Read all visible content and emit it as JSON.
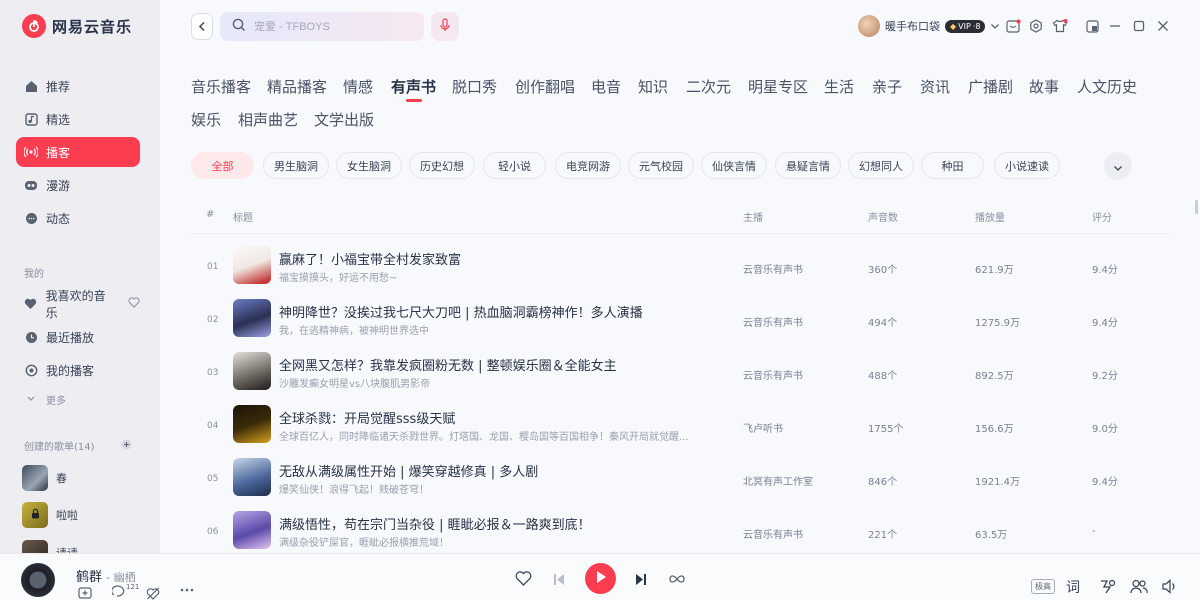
{
  "app": {
    "title": "网易云音乐",
    "accent": "#fc3d4f"
  },
  "sidebar": {
    "nav": [
      {
        "label": "推荐",
        "icon": "home-icon"
      },
      {
        "label": "精选",
        "icon": "music-note-icon"
      },
      {
        "label": "播客",
        "icon": "radio-icon",
        "active": true
      },
      {
        "label": "漫游",
        "icon": "glasses-icon"
      },
      {
        "label": "动态",
        "icon": "chat-icon"
      }
    ],
    "mine_label": "我的",
    "mine": [
      {
        "label": "我喜欢的音乐",
        "icon": "heart-icon"
      },
      {
        "label": "最近播放",
        "icon": "clock-icon"
      },
      {
        "label": "我的播客",
        "icon": "podcast-icon"
      }
    ],
    "more_label": "更多",
    "playlists_label": "创建的歌单(14)",
    "playlists": [
      {
        "name": "春"
      },
      {
        "name": "啦啦"
      },
      {
        "name": "请请"
      }
    ]
  },
  "topbar": {
    "search_placeholder": "宠爱 - TFBOYS",
    "user_name": "暖手布口袋",
    "vip_label": "VIP·",
    ".vip_level": "8",
    "vip_text": "VIP"
  },
  "categories": [
    "音乐播客",
    "精品播客",
    "情感",
    "有声书",
    "脱口秀",
    "创作翻唱",
    "电音",
    "知识",
    "二次元",
    "明星专区",
    "生活",
    "亲子",
    "资讯",
    "广播剧",
    "故事",
    "人文历史",
    "娱乐",
    "相声曲艺",
    "文学出版"
  ],
  "active_category": "有声书",
  "chips": [
    "全部",
    "男生脑洞",
    "女生脑洞",
    "历史幻想",
    "轻小说",
    "电竞网游",
    "元气校园",
    "仙侠言情",
    "悬疑言情",
    "幻想同人",
    "种田",
    "小说速读"
  ],
  "table": {
    "headers": {
      "idx": "#",
      "title": "标题",
      "host": "主播",
      "count": "声音数",
      "plays": "播放量",
      "score": "评分"
    },
    "rows": [
      {
        "idx": "01",
        "title": "赢麻了！小福宝带全村发家致富",
        "sub": "福宝摸摸头，好运不用愁~",
        "host": "云音乐有声书",
        "count": "360个",
        "plays": "621.9万",
        "score": "9.4分"
      },
      {
        "idx": "02",
        "title": "神明降世？没挨过我七尺大刀吧 | 热血脑洞霸榜神作！多人演播",
        "sub": "我，在逃精神病，被神明世界选中",
        "host": "云音乐有声书",
        "count": "494个",
        "plays": "1275.9万",
        "score": "9.4分"
      },
      {
        "idx": "03",
        "title": "全网黑又怎样？我靠发疯圈粉无数 | 整顿娱乐圈＆全能女主",
        "sub": "沙雕发癫女明星vs八块腹肌男影帝",
        "host": "云音乐有声书",
        "count": "488个",
        "plays": "892.5万",
        "score": "9.2分"
      },
      {
        "idx": "04",
        "title": "全球杀戮：开局觉醒sss级天赋",
        "sub": "全球百亿人，同时降临诸天杀戮世界。灯塔国、龙国、樱岛国等百国相争！秦风开局就觉醒...",
        "host": "飞卢听书",
        "count": "1755个",
        "plays": "156.6万",
        "score": "9.0分"
      },
      {
        "idx": "05",
        "title": "无敌从满级属性开始 | 爆笑穿越修真 | 多人剧",
        "sub": "爆笑仙侠！浪得飞起！贱破苍穹！",
        "host": "北冥有声工作室",
        "count": "846个",
        "plays": "1921.4万",
        "score": "9.4分"
      },
      {
        "idx": "06",
        "title": "满级悟性，苟在宗门当杂役 | 睚眦必报＆一路爽到底！",
        "sub": "满级杂役铲屎官，睚眦必报横推荒域！",
        "host": "云音乐有声书",
        "count": "221个",
        "plays": "63.5万",
        "score": "-"
      }
    ]
  },
  "player": {
    "song": "鹤群",
    "artist": "幽栖",
    "comment_count": "121",
    "quality": "极高",
    "lyrics_label": "词"
  }
}
